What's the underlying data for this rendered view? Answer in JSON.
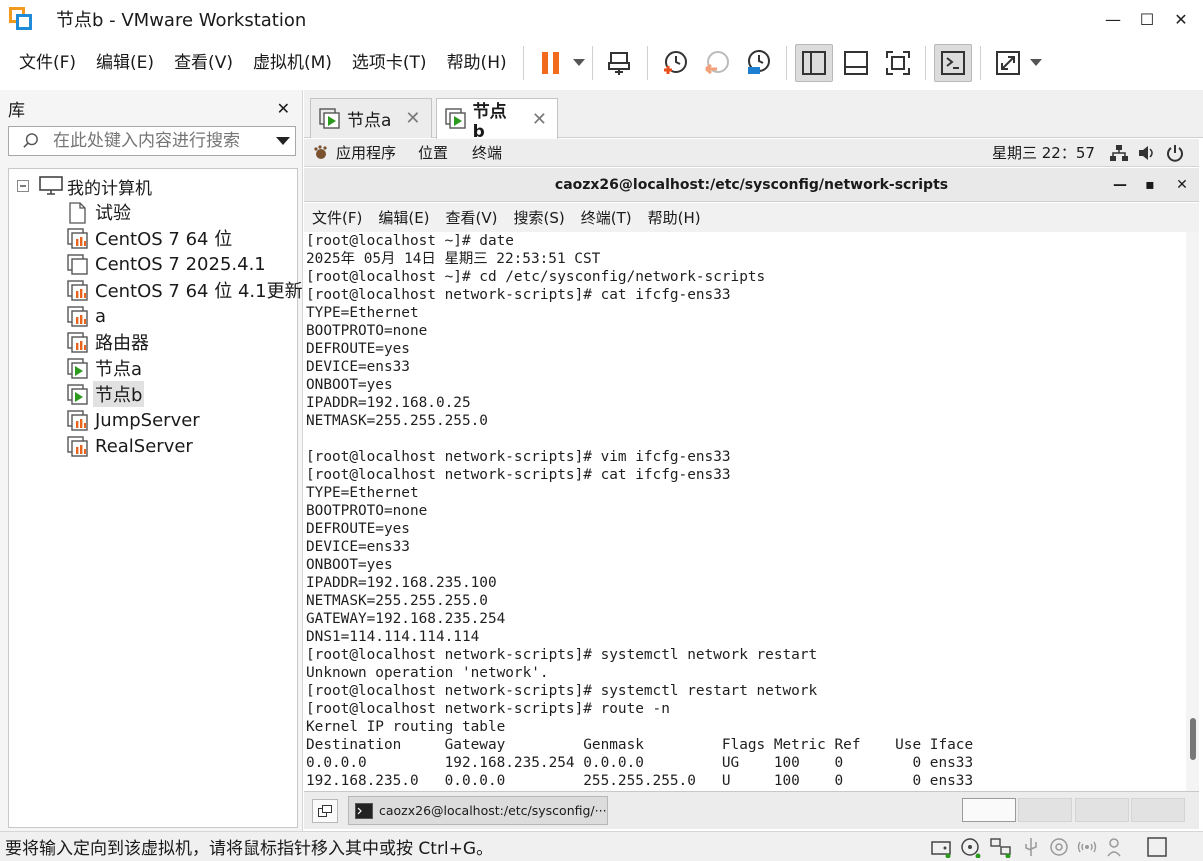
{
  "window": {
    "title": "节点b - VMware Workstation",
    "minimize": "—",
    "maximize": "☐",
    "close": "✕"
  },
  "menu": {
    "file": "文件(F)",
    "edit": "编辑(E)",
    "view": "查看(V)",
    "vm": "虚拟机(M)",
    "tabs": "选项卡(T)",
    "help": "帮助(H)"
  },
  "library": {
    "title": "库",
    "close": "✕",
    "search_placeholder": "在此处键入内容进行搜索",
    "root": "我的计算机",
    "items": [
      {
        "label": "试验",
        "icon": "template-icon",
        "selected": false
      },
      {
        "label": "CentOS 7 64 位",
        "icon": "vm-off-icon",
        "selected": false
      },
      {
        "label": "CentOS 7 2025.4.1",
        "icon": "vm-plain-icon",
        "selected": false
      },
      {
        "label": "CentOS 7 64 位 4.1更新",
        "icon": "vm-off-icon",
        "selected": false
      },
      {
        "label": "a",
        "icon": "vm-off-icon",
        "selected": false
      },
      {
        "label": "路由器",
        "icon": "vm-off-icon",
        "selected": false
      },
      {
        "label": "节点a",
        "icon": "vm-running-icon",
        "selected": false
      },
      {
        "label": "节点b",
        "icon": "vm-running-icon",
        "selected": true
      },
      {
        "label": "JumpServer",
        "icon": "vm-off-icon",
        "selected": false
      },
      {
        "label": "RealServer",
        "icon": "vm-off-icon",
        "selected": false
      }
    ]
  },
  "tabs": [
    {
      "label": "节点a",
      "active": false
    },
    {
      "label": "节点b",
      "active": true
    }
  ],
  "gnome": {
    "applications": "应用程序",
    "places": "位置",
    "terminal": "终端",
    "clock": "星期三 22：57"
  },
  "terminal": {
    "title": "caozx26@localhost:/etc/sysconfig/network-scripts",
    "menu": [
      "文件(F)",
      "编辑(E)",
      "查看(V)",
      "搜索(S)",
      "终端(T)",
      "帮助(H)"
    ],
    "lines": [
      "[root@localhost ~]# date",
      "2025年 05月 14日 星期三 22:53:51 CST",
      "[root@localhost ~]# cd /etc/sysconfig/network-scripts",
      "[root@localhost network-scripts]# cat ifcfg-ens33",
      "TYPE=Ethernet",
      "BOOTPROTO=none",
      "DEFROUTE=yes",
      "DEVICE=ens33",
      "ONBOOT=yes",
      "IPADDR=192.168.0.25",
      "NETMASK=255.255.255.0",
      "",
      "[root@localhost network-scripts]# vim ifcfg-ens33",
      "[root@localhost network-scripts]# cat ifcfg-ens33",
      "TYPE=Ethernet",
      "BOOTPROTO=none",
      "DEFROUTE=yes",
      "DEVICE=ens33",
      "ONBOOT=yes",
      "IPADDR=192.168.235.100",
      "NETMASK=255.255.255.0",
      "GATEWAY=192.168.235.254",
      "DNS1=114.114.114.114",
      "[root@localhost network-scripts]# systemctl network restart",
      "Unknown operation 'network'.",
      "[root@localhost network-scripts]# systemctl restart network",
      "[root@localhost network-scripts]# route -n",
      "Kernel IP routing table",
      "Destination     Gateway         Genmask         Flags Metric Ref    Use Iface",
      "0.0.0.0         192.168.235.254 0.0.0.0         UG    100    0        0 ens33",
      "192.168.235.0   0.0.0.0         255.255.255.0   U     100    0        0 ens33"
    ]
  },
  "guest_taskbar": {
    "window_label": "caozx26@localhost:/etc/sysconfig/···"
  },
  "statusbar": {
    "message": "要将输入定向到该虚拟机，请将鼠标指针移入其中或按 Ctrl+G。"
  }
}
